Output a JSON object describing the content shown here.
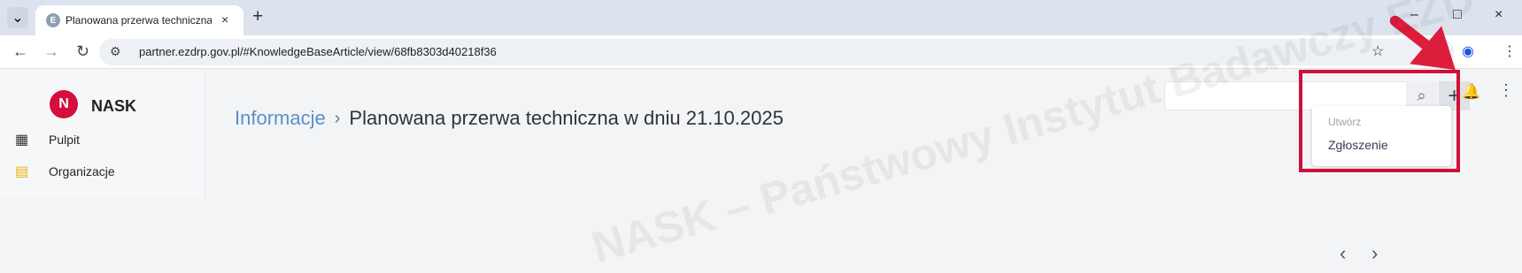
{
  "browser": {
    "tab": {
      "title": "Planowana przerwa techniczna",
      "favicon": "E"
    },
    "url": "partner.ezdrp.gov.pl/#KnowledgeBaseArticle/view/68fb8303d40218f36",
    "window_controls": {
      "minimize": "–",
      "maximize": "□",
      "close": "×"
    },
    "icons": {
      "tab_menu": "⌄",
      "back": "←",
      "forward": "→",
      "reload": "↻",
      "site_info": "⚙",
      "bookmark": "☆",
      "profile": "◉",
      "menu": "⋮"
    }
  },
  "app": {
    "logo_text": "NASK",
    "sidebar": [
      {
        "label": "Pulpit",
        "icon": "▦"
      },
      {
        "label": "Organizacje",
        "icon": "▤"
      }
    ],
    "search": {
      "placeholder": ""
    },
    "toolbar_icons": {
      "search": "⌕",
      "add": "+",
      "bell": "🔔",
      "more": "⋮"
    },
    "breadcrumb": {
      "parent": "Informacje",
      "separator": "›",
      "current": "Planowana przerwa techniczna w dniu 21.10.2025"
    },
    "dropdown": {
      "heading": "Utwórz",
      "item": "Zgłoszenie"
    },
    "pager": {
      "previous": "‹",
      "next": "›"
    },
    "watermark": "NASK – Państwowy Instytut Badawczy EZD"
  },
  "colors": {
    "accent_red": "#d0103a",
    "link_blue": "#5b8fc7",
    "nask_red": "#d40e3d"
  }
}
